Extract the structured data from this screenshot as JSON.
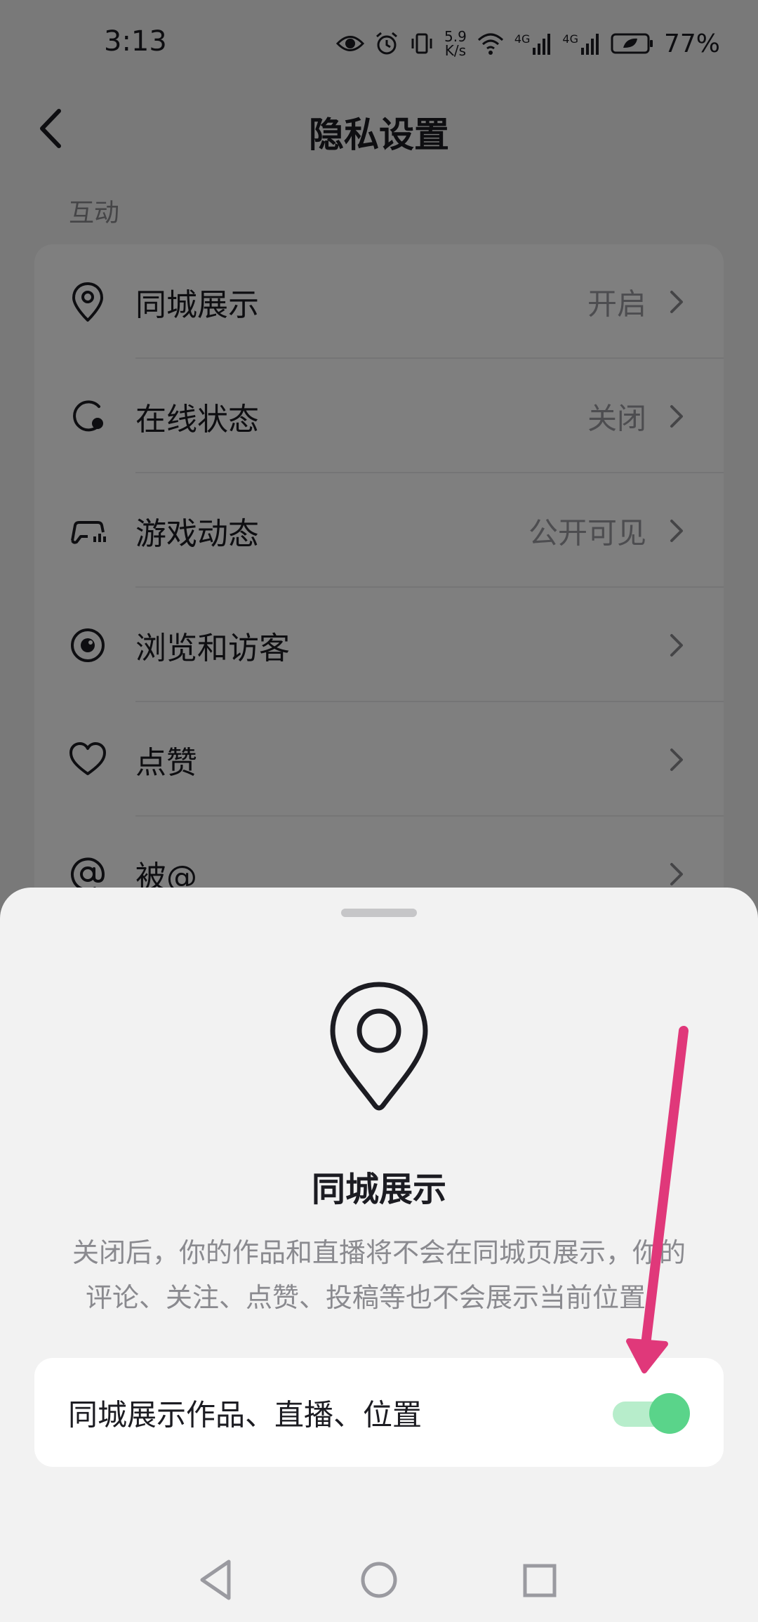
{
  "status_bar": {
    "time": "3:13",
    "net_speed_value": "5.9",
    "net_speed_unit": "K/s",
    "signal_1_label": "4G",
    "signal_2_label": "4G",
    "battery": "77%"
  },
  "header": {
    "title": "隐私设置",
    "back_icon": "chevron-left-icon"
  },
  "section": {
    "label": "互动"
  },
  "settings": {
    "items": [
      {
        "label": "同城展示",
        "value": "开启",
        "icon": "location-pin-icon"
      },
      {
        "label": "在线状态",
        "value": "关闭",
        "icon": "online-status-icon"
      },
      {
        "label": "游戏动态",
        "value": "公开可见",
        "icon": "game-controller-icon"
      },
      {
        "label": "浏览和访客",
        "value": "",
        "icon": "eye-icon"
      },
      {
        "label": "点赞",
        "value": "",
        "icon": "heart-icon"
      },
      {
        "label": "被@",
        "value": "",
        "icon": "at-sign-icon"
      }
    ]
  },
  "sheet": {
    "icon": "location-pin-icon",
    "title": "同城展示",
    "description_line1": "关闭后，你的作品和直播将不会在同城页展示，你的",
    "description_line2": "评论、关注、点赞、投稿等也不会展示当前位置。",
    "toggle_label": "同城展示作品、直播、位置",
    "toggle_on": true
  },
  "colors": {
    "toggle_track": "#b7edcb",
    "toggle_thumb": "#5ad48a",
    "annotation_arrow": "#e0387a"
  },
  "nav": {
    "back_icon": "triangle-back-icon",
    "home_icon": "circle-home-icon",
    "recents_icon": "square-recents-icon"
  }
}
